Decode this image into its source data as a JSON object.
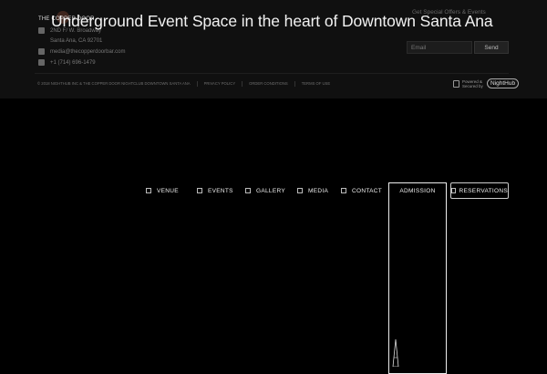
{
  "footer": {
    "logo_text": "THE COPPER DOOR",
    "address_line1": "2ND F/ W. Broadway",
    "address_line2": "Santa Ana, CA 92701",
    "email": "media@thecopperdoorbar.com",
    "phone": "+1 (714) 696-1479",
    "newsletter_label": "Get Special Offers & Events",
    "search_placeholder": "Email",
    "send_label": "Send",
    "legal": [
      "© 2018 NIGHTHUB INC & THE COPPER DOOR NIGHTCLUB DOWNTOWN SANTA ANA",
      "PRIVACY POLICY",
      "ORDER CONDITIONS",
      "TERMS OF USE"
    ],
    "powered_by": "Powered & Secured by",
    "powered_brand": "NightHub"
  },
  "headline": "Underground Event Space in the heart of Downtown Santa Ana",
  "nav": {
    "venue": "VENUE",
    "events": "EVENTS",
    "gallery": "GALLERY",
    "media": "MEDIA",
    "contact": "CONTACT",
    "admission": "ADMISSION",
    "reservations": "RESERVATIONS"
  },
  "icons": {
    "venue": "building-icon",
    "events": "calendar-icon",
    "gallery": "image-icon",
    "media": "document-icon",
    "contact": "envelope-icon",
    "reservations": "ticket-icon"
  }
}
